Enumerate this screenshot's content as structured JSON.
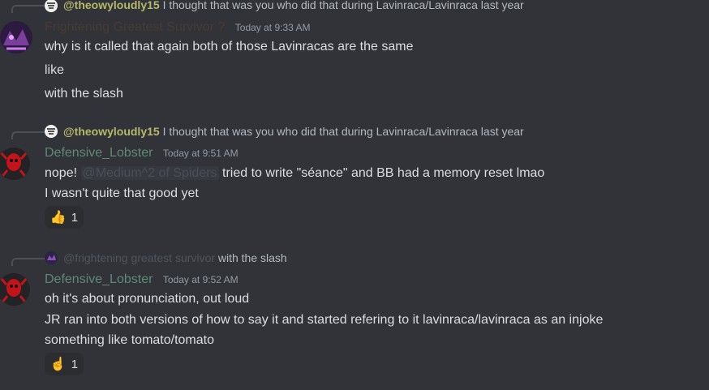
{
  "messages": [
    {
      "reply": {
        "author": "@theowyloudly15",
        "text": "I thought that was you who did that during Lavinraca/Lavinraca last year"
      },
      "author": "Frightening Greatest Survivor ?",
      "timestamp": "Today at 9:33 AM",
      "lines": [
        "why is it called that again both of those Lavinracas are the same",
        "like",
        "with the slash"
      ]
    },
    {
      "reply": {
        "author": "@theowyloudly15",
        "text": "I thought that was you who did that during Lavinraca/Lavinraca last year"
      },
      "author": "Defensive_Lobster",
      "timestamp": "Today at 9:51 AM",
      "line1_pre": "nope!",
      "mention": "@Medium^2 of Spiders",
      "line1_post": "tried to write \"séance\" and BB had a memory reset lmao",
      "line2": "I wasn't quite that good yet",
      "reaction": {
        "emoji": "👍",
        "count": "1"
      }
    },
    {
      "reply": {
        "author": "@frightening greatest survivor",
        "text": "with the slash"
      },
      "author": "Defensive_Lobster",
      "timestamp": "Today at 9:52 AM",
      "lines": [
        "oh it's about pronunciation, out loud",
        "JR ran into both versions of how to say it and started refering to it lavinraca/lavinraca as an injoke",
        "something like tomato/tomato"
      ],
      "reaction": {
        "emoji": "☝️",
        "count": "1"
      }
    }
  ]
}
